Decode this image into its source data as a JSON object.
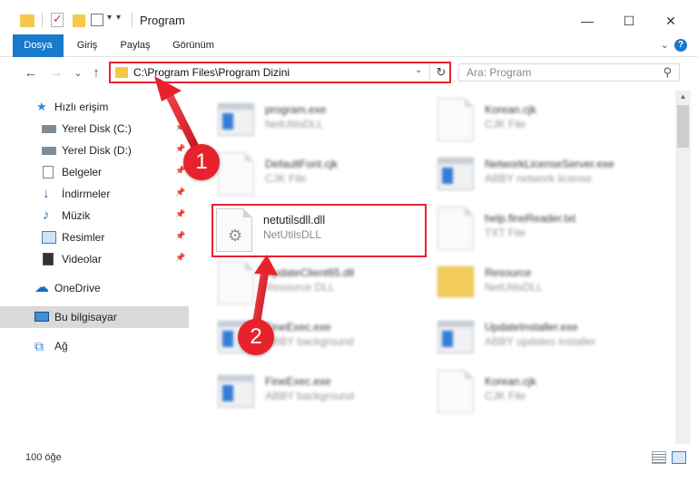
{
  "window": {
    "title": "Program",
    "minimize": "—",
    "maximize": "☐",
    "close": "✕"
  },
  "ribbon": {
    "tabs": [
      "Dosya",
      "Giriş",
      "Paylaş",
      "Görünüm"
    ],
    "help": "?",
    "collapse": "⌄"
  },
  "navigation": {
    "back": "←",
    "forward": "→",
    "recent": "⌄",
    "up": "↑",
    "address": "C:\\Program Files\\Program Dizini",
    "search_placeholder": "Ara: Program"
  },
  "sidebar": {
    "items": [
      {
        "label": "Hızlı erişim",
        "icon": "star-icon",
        "pinned": false
      },
      {
        "label": "Yerel Disk (C:)",
        "icon": "disk-icon",
        "pinned": true
      },
      {
        "label": "Yerel Disk (D:)",
        "icon": "disk-icon",
        "pinned": true
      },
      {
        "label": "Belgeler",
        "icon": "documents-icon",
        "pinned": true
      },
      {
        "label": "İndirmeler",
        "icon": "download-icon",
        "pinned": true
      },
      {
        "label": "Müzik",
        "icon": "music-icon",
        "pinned": true
      },
      {
        "label": "Resimler",
        "icon": "pictures-icon",
        "pinned": true
      },
      {
        "label": "Videolar",
        "icon": "videos-icon",
        "pinned": true
      },
      {
        "label": "OneDrive",
        "icon": "cloud-icon",
        "pinned": false
      },
      {
        "label": "Bu bilgisayar",
        "icon": "computer-icon",
        "pinned": false
      },
      {
        "label": "Ağ",
        "icon": "network-icon",
        "pinned": false
      }
    ],
    "pin_glyph": "📌"
  },
  "files": [
    {
      "name": "program.exe",
      "type": "NetUtilsDLL",
      "kind": "exe"
    },
    {
      "name": "Korean.cjk",
      "type": "CJK File",
      "kind": "page"
    },
    {
      "name": "DefaultFont.cjk",
      "type": "CJK File",
      "kind": "page"
    },
    {
      "name": "NetworkLicenseServer.exe",
      "type": "ABBY network license",
      "kind": "exe"
    },
    {
      "name": "netutilsdll.dll",
      "type": "NetUtilsDLL",
      "kind": "dll"
    },
    {
      "name": "help.fineReader.txt",
      "type": "TXT File",
      "kind": "page"
    },
    {
      "name": "UpdateClient65.dll",
      "type": "Resource DLL",
      "kind": "dll"
    },
    {
      "name": "Resource",
      "type": "NetUtilsDLL",
      "kind": "folder"
    },
    {
      "name": "FineExec.exe",
      "type": "ABBY background",
      "kind": "exe"
    },
    {
      "name": "UpdateInstaller.exe",
      "type": "ABBY updates installer",
      "kind": "exe"
    },
    {
      "name": "FineExec.exe",
      "type": "ABBY background",
      "kind": "exe"
    },
    {
      "name": "Korean.cjk",
      "type": "CJK File",
      "kind": "page"
    }
  ],
  "status": {
    "item_count": "100 öğe"
  },
  "callouts": {
    "step1": "1",
    "step2": "2"
  },
  "colors": {
    "accent": "#1979ca",
    "highlight_red": "#e8222d",
    "folder_yellow": "#f4c84b",
    "selected_bg": "#d9d9d9"
  }
}
